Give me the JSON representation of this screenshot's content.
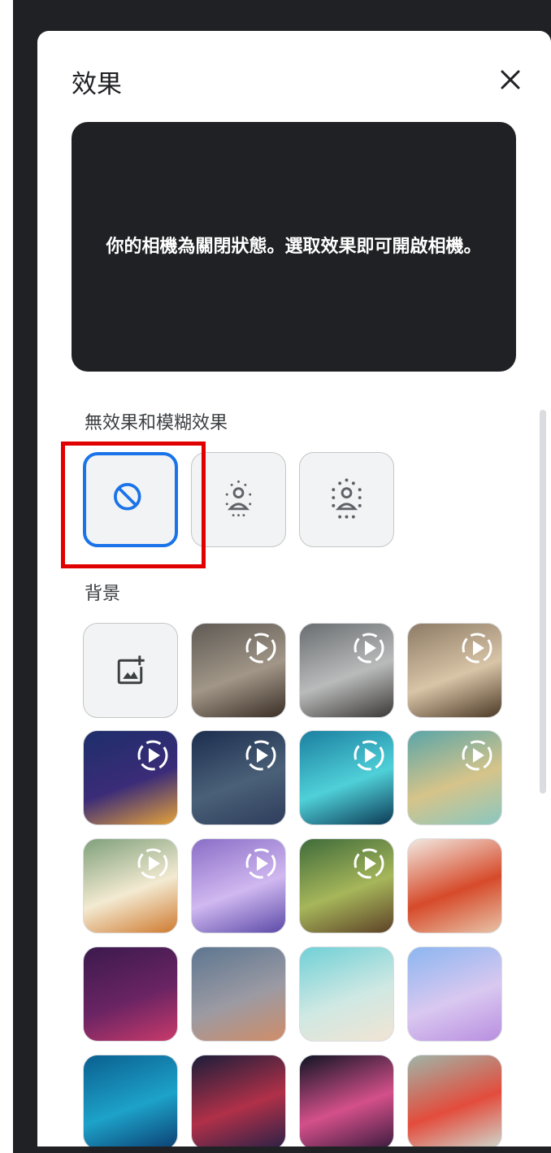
{
  "panel": {
    "title": "效果",
    "close_icon": "close-icon"
  },
  "preview": {
    "message": "你的相機為關閉狀態。選取效果即可開啟相機。"
  },
  "sections": {
    "blur_label": "無效果和模糊效果",
    "background_label": "背景"
  },
  "blur_options": [
    {
      "icon": "no-effect-icon",
      "selected": true
    },
    {
      "icon": "slight-blur-icon",
      "selected": false
    },
    {
      "icon": "blur-icon",
      "selected": false
    }
  ],
  "backgrounds": [
    {
      "type": "upload",
      "icon": "add-image-icon"
    },
    {
      "type": "animated",
      "colors": [
        "#5f5a55",
        "#a19687",
        "#3a2e26"
      ]
    },
    {
      "type": "animated",
      "colors": [
        "#6a6d70",
        "#b9bbbb",
        "#3b3835"
      ]
    },
    {
      "type": "animated",
      "colors": [
        "#8d7b66",
        "#d8c4a6",
        "#4d3a27"
      ]
    },
    {
      "type": "animated",
      "colors": [
        "#1d2e6b",
        "#3b2c78",
        "#e5a23a"
      ]
    },
    {
      "type": "animated",
      "colors": [
        "#1c2e4f",
        "#4a6078",
        "#2e3d5c"
      ]
    },
    {
      "type": "animated",
      "colors": [
        "#1b7fa0",
        "#4fd0d8",
        "#0c3a55"
      ]
    },
    {
      "type": "animated",
      "colors": [
        "#5aa5a8",
        "#d6c48a",
        "#8ac7c0"
      ]
    },
    {
      "type": "animated",
      "colors": [
        "#7fa07a",
        "#f3ead2",
        "#cf7a2f"
      ]
    },
    {
      "type": "animated",
      "colors": [
        "#8a6dc7",
        "#d0b8f0",
        "#5b4aa8"
      ]
    },
    {
      "type": "animated",
      "colors": [
        "#3f6b3a",
        "#a6b65a",
        "#5d4127"
      ]
    },
    {
      "type": "image",
      "colors": [
        "#f2e9e1",
        "#d64a2a",
        "#e8c3a8"
      ]
    },
    {
      "type": "image",
      "colors": [
        "#3b1a4d",
        "#6a2463",
        "#c93a6b"
      ]
    },
    {
      "type": "image",
      "colors": [
        "#5d7690",
        "#9b9aa3",
        "#d08d68"
      ]
    },
    {
      "type": "image",
      "colors": [
        "#6fd0d6",
        "#cfe8e3",
        "#f1e4d3"
      ]
    },
    {
      "type": "image",
      "colors": [
        "#8bb6f0",
        "#d9c8f0",
        "#b98ee0"
      ]
    },
    {
      "type": "image",
      "colors": [
        "#0a5f8f",
        "#1da2c9",
        "#0b3f72"
      ]
    },
    {
      "type": "image",
      "colors": [
        "#1b1e3a",
        "#b03048",
        "#2a2147"
      ]
    },
    {
      "type": "image",
      "colors": [
        "#101424",
        "#d4508a",
        "#3b1b3e"
      ]
    },
    {
      "type": "image",
      "colors": [
        "#9fb5a8",
        "#e34c3c",
        "#cfd9cf"
      ]
    }
  ]
}
